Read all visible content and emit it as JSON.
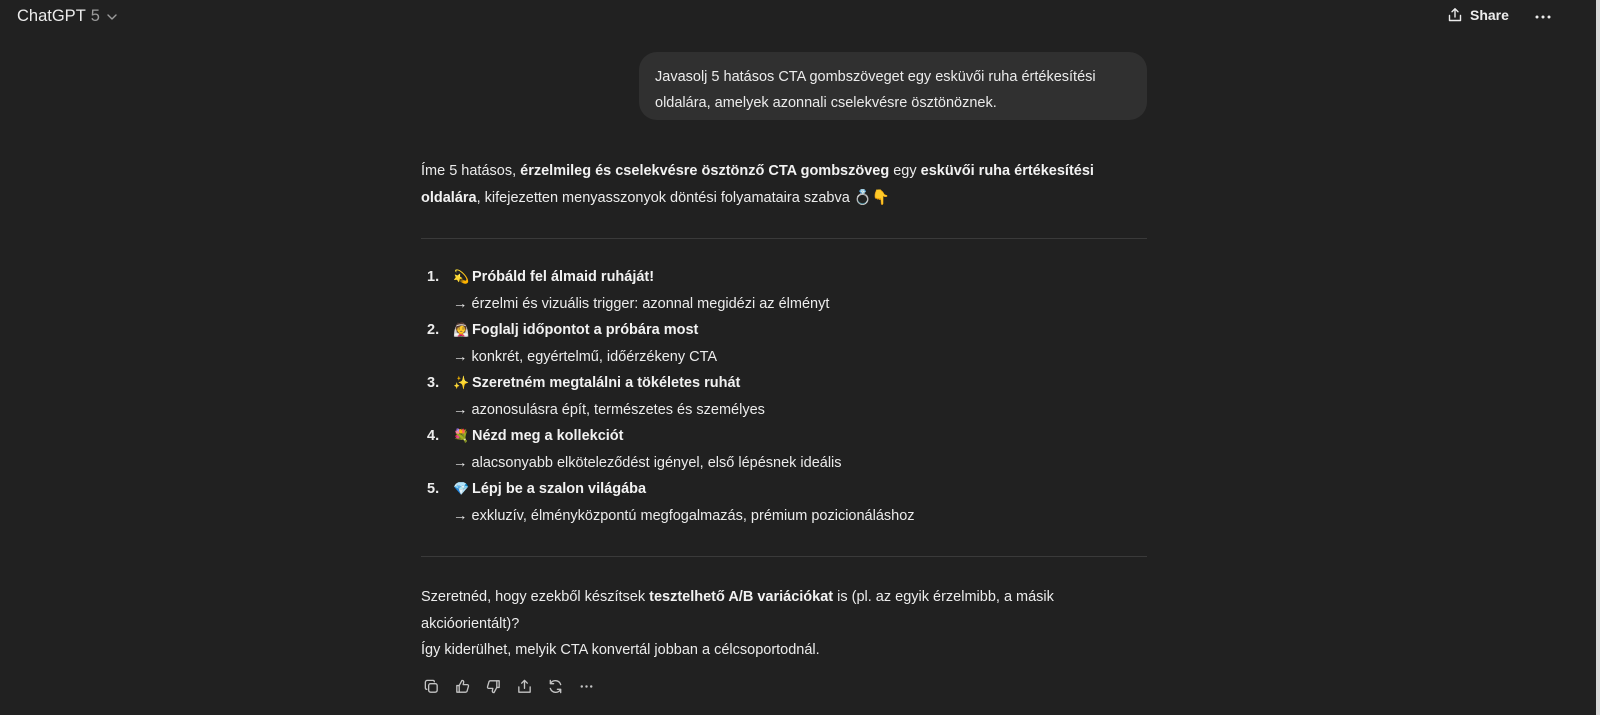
{
  "header": {
    "model_name": "ChatGPT",
    "model_version": "5",
    "share_label": "Share"
  },
  "user_message": {
    "text": "Javasolj 5 hatásos CTA gombszöveget egy esküvői ruha értékesítési oldalára, amelyek azonnali cselekvésre ösztönöznek."
  },
  "assistant": {
    "intro": {
      "p1": "Íme 5 hatásos, ",
      "b1": "érzelmileg és cselekvésre ösztönző CTA gombszöveg",
      "p2": " egy ",
      "b2": "esküvői ruha értékesítési oldalára",
      "p3": ", kifejezetten menyasszonyok döntési folyamataira szabva 💍👇"
    },
    "items": [
      {
        "number": "1.",
        "emoji": "💫",
        "title": "Próbáld fel álmaid ruháját!",
        "note": "→ érzelmi és vizuális trigger: azonnal megidézi az élményt"
      },
      {
        "number": "2.",
        "emoji": "👰",
        "title": "Foglalj időpontot a próbára most",
        "note": "→ konkrét, egyértelmű, időérzékeny CTA"
      },
      {
        "number": "3.",
        "emoji": "✨",
        "title": "Szeretném megtalálni a tökéletes ruhát",
        "note": "→ azonosulásra épít, természetes és személyes"
      },
      {
        "number": "4.",
        "emoji": "💐",
        "title": "Nézd meg a kollekciót",
        "note": "→ alacsonyabb elköteleződést igényel, első lépésnek ideális"
      },
      {
        "number": "5.",
        "emoji": "💎",
        "title": "Lépj be a szalon világába",
        "note": "→ exkluzív, élményközpontú megfogalmazás, prémium pozicionáláshoz"
      }
    ],
    "outro": {
      "p1": "Szeretnéd, hogy ezekből készítsek ",
      "b1": "tesztelhető A/B variációkat",
      "p2": " is (pl. az egyik érzelmibb, a másik akcióorientált)?",
      "line2": "Így kiderülhet, melyik CTA konvertál jobban a célcsoportodnál."
    }
  },
  "icons": {
    "model_chevron": "chevron-down-icon",
    "share": "share-icon",
    "more": "more-horizontal-icon",
    "actions": [
      "copy-icon",
      "thumbs-up-icon",
      "thumbs-down-icon",
      "share-icon",
      "regenerate-icon",
      "more-horizontal-icon"
    ]
  },
  "colors": {
    "background": "#212121",
    "bubble": "#303030",
    "text": "#ececec",
    "muted": "#9b9b9b"
  }
}
